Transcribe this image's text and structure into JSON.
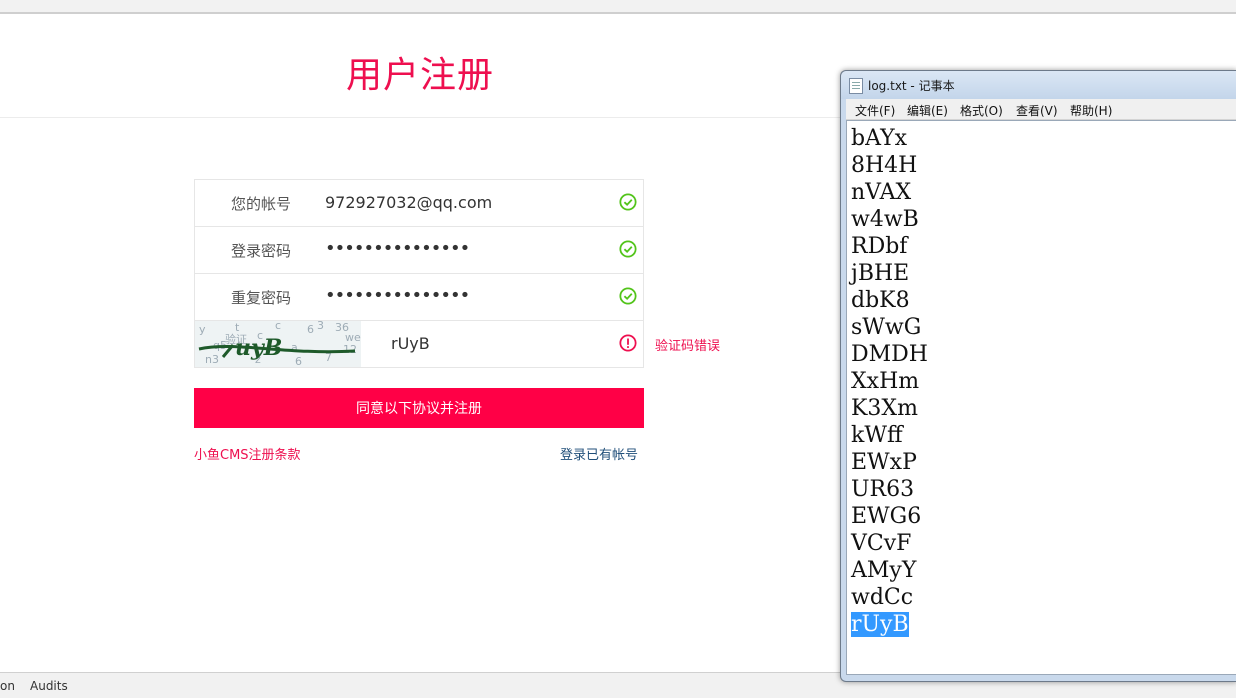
{
  "page": {
    "title": "用户注册",
    "form": {
      "account_label": "您的帐号",
      "account_value": "972927032@qq.com",
      "password_label": "登录密码",
      "password_value": "•••••••••••••••",
      "repeat_label": "重复密码",
      "repeat_value": "•••••••••••••••",
      "captcha_value": "rUyB",
      "captcha_error": "验证码错误"
    },
    "submit_label": "同意以下协议并注册",
    "terms_link": "小鱼CMS注册条款",
    "login_link": "登录已有帐号",
    "colors": {
      "accent": "#ff0046",
      "title": "#ee0f4f",
      "ok": "#52c41a",
      "link": "#1f4e79"
    }
  },
  "devtools": {
    "tab_left": "on",
    "tab_audits": "Audits"
  },
  "notepad": {
    "title": "log.txt - 记事本",
    "menu": [
      "文件(F)",
      "编辑(E)",
      "格式(O)",
      "查看(V)",
      "帮助(H)"
    ],
    "lines": [
      "bAYx",
      "8H4H",
      "nVAX",
      "w4wB",
      "RDbf",
      "jBHE",
      "dbK8",
      "sWwG",
      "DMDH",
      "XxHm",
      "K3Xm",
      "kWff",
      "EWxP",
      "UR63",
      "EWG6",
      "VCvF",
      "AMyY",
      "wdCc"
    ],
    "selected_line": "rUyB"
  }
}
